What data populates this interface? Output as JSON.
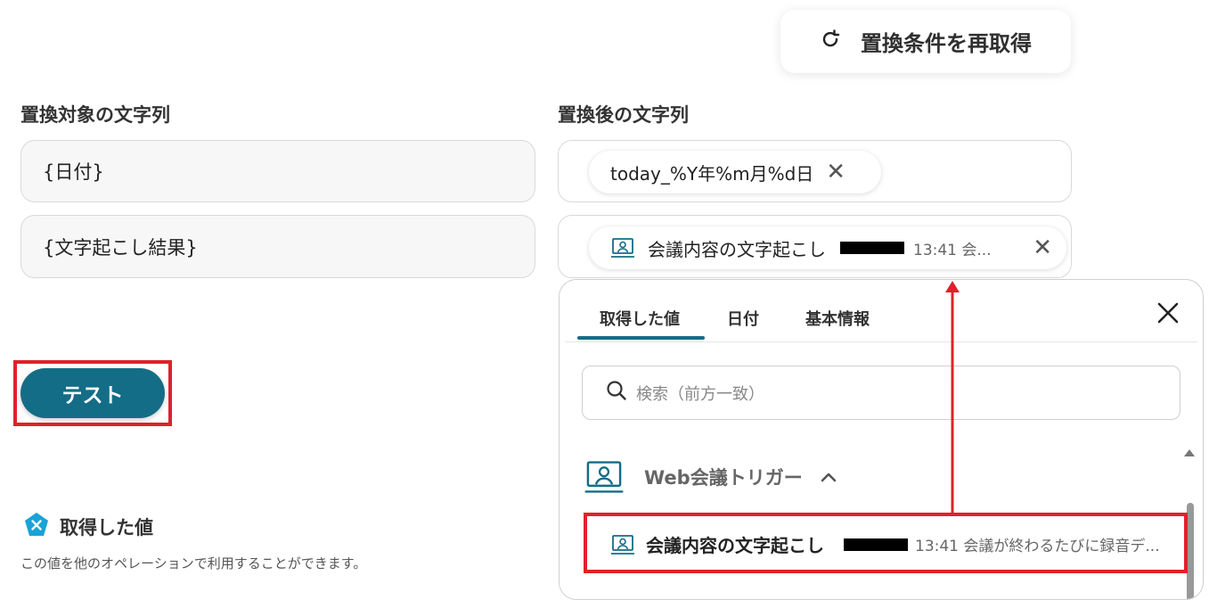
{
  "refetch_button": {
    "label": "置換条件を再取得",
    "icon": "refresh-icon"
  },
  "left": {
    "label": "置換対象の文字列",
    "fields": [
      "{日付}",
      "{文字起こし結果}"
    ]
  },
  "right": {
    "label": "置換後の文字列",
    "chip1": {
      "text": "today_%Y年%m月%d日"
    },
    "chip2": {
      "icon": "meeting-icon",
      "title": "会議内容の文字起こし",
      "time": "13:41 会..."
    }
  },
  "test_button": {
    "label": "テスト"
  },
  "acquired": {
    "title": "取得した値",
    "icon": "close-badge-icon",
    "description": "この値を他のオペレーションで利用することができます。"
  },
  "panel": {
    "tabs": [
      "取得した値",
      "日付",
      "基本情報"
    ],
    "active_tab": 0,
    "search_placeholder": "検索（前方一致）",
    "group": {
      "icon": "meeting-icon",
      "label": "Web会議トリガー"
    },
    "item": {
      "title": "会議内容の文字起こし",
      "description": "13:41 会議が終わるたびに録音デ..."
    }
  },
  "colors": {
    "accent": "#146d86",
    "highlight": "#e0212b",
    "badge": "#19a3d6"
  }
}
